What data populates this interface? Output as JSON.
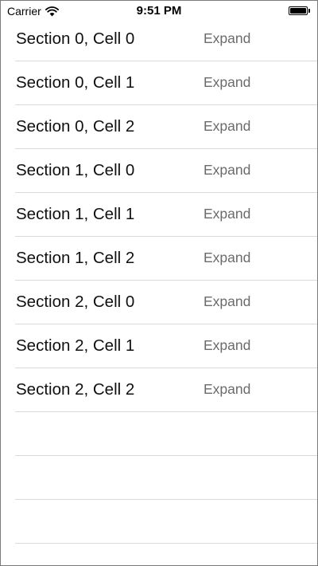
{
  "status_bar": {
    "carrier": "Carrier",
    "time": "9:51 PM",
    "wifi_icon": "wifi-icon",
    "battery_icon": "battery-icon",
    "battery_level": 1.0
  },
  "table": {
    "rows": [
      {
        "title": "Section 0, Cell 0",
        "action": "Expand"
      },
      {
        "title": "Section 0, Cell 1",
        "action": "Expand"
      },
      {
        "title": "Section 0, Cell 2",
        "action": "Expand"
      },
      {
        "title": "Section 1, Cell 0",
        "action": "Expand"
      },
      {
        "title": "Section 1, Cell 1",
        "action": "Expand"
      },
      {
        "title": "Section 1, Cell 2",
        "action": "Expand"
      },
      {
        "title": "Section 2, Cell 0",
        "action": "Expand"
      },
      {
        "title": "Section 2, Cell 1",
        "action": "Expand"
      },
      {
        "title": "Section 2, Cell 2",
        "action": "Expand"
      }
    ],
    "empty_rows": 4
  },
  "colors": {
    "separator": "#d9d9d9",
    "title_text": "#111111",
    "action_text": "#6b6b6b",
    "background": "#ffffff"
  }
}
